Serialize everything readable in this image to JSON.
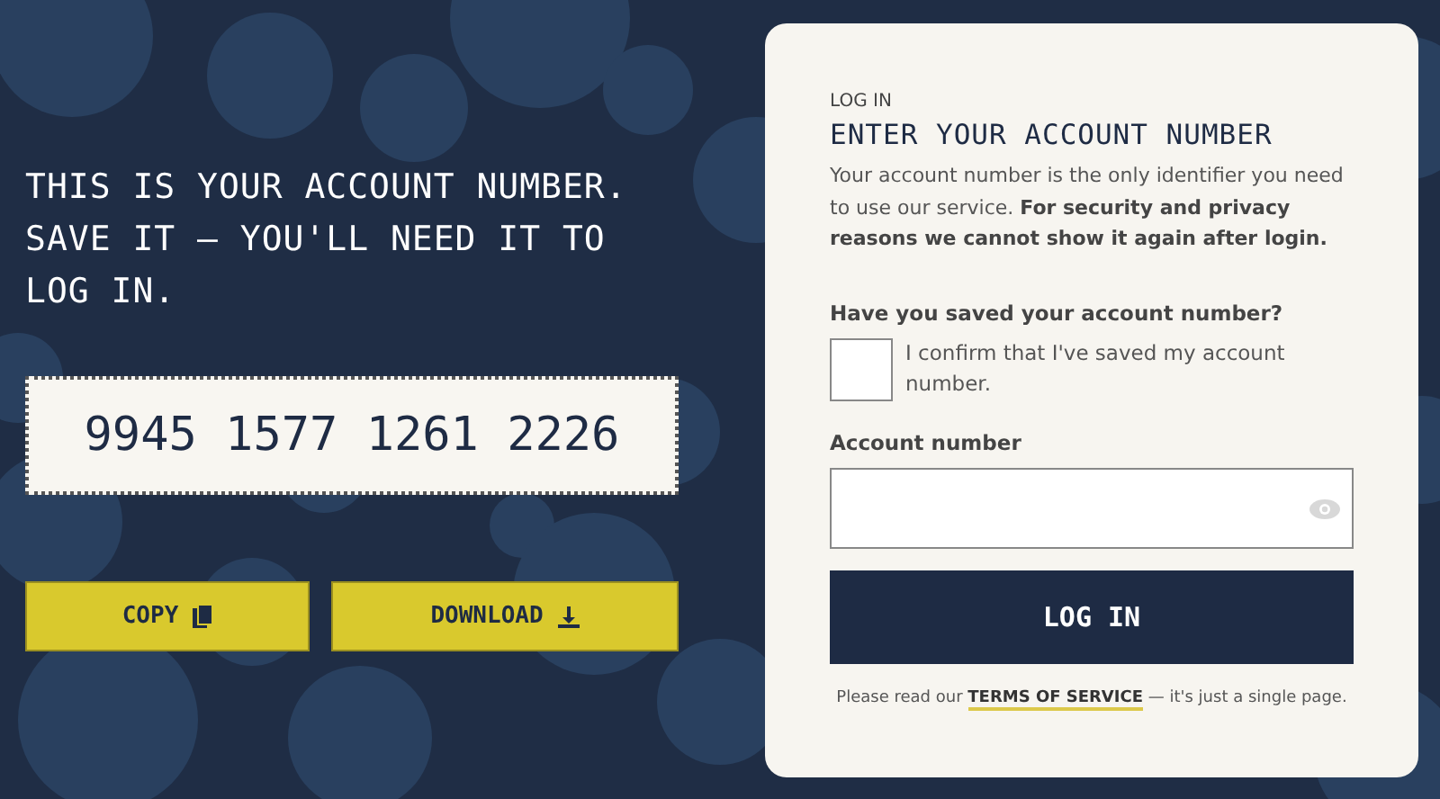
{
  "headline": "THIS IS YOUR ACCOUNT NUMBER. SAVE IT — YOU'LL NEED IT TO LOG IN.",
  "account_number": "9945 1577 1261 2226",
  "actions": [
    {
      "label": "COPY",
      "kind": "copy"
    },
    {
      "label": "DOWNLOAD",
      "kind": "download"
    }
  ],
  "login": {
    "eyebrow": "LOG IN",
    "title": "ENTER YOUR ACCOUNT NUMBER",
    "description": "Your account number is the only identifier you need to use our service. **For security and privacy reasons we cannot show it again after login.**",
    "question": "Have you saved your account number?",
    "confirm": {
      "label": "I confirm that I've saved my account number.",
      "checked": false
    },
    "field_label": "Account number",
    "submit": "LOG IN",
    "footer": {
      "before": "Please read our",
      "link": "TERMS OF SERVICE",
      "after": "— it's just a single page."
    }
  }
}
